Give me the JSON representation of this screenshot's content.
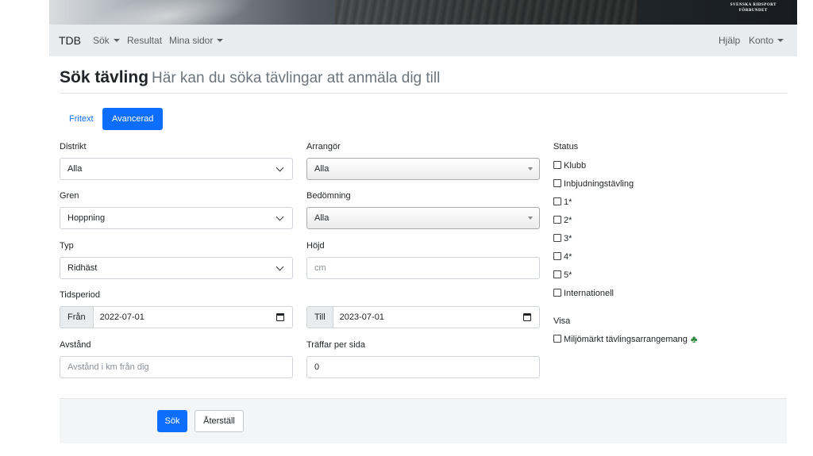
{
  "banner": {
    "logo_line1": "SVENSKA RIDSPORT",
    "logo_line2": "FÖRBUNDET"
  },
  "navbar": {
    "brand": "TDB",
    "items": [
      {
        "label": "Sök",
        "dropdown": true
      },
      {
        "label": "Resultat",
        "dropdown": false
      },
      {
        "label": "Mina sidor",
        "dropdown": true
      }
    ],
    "right_items": [
      {
        "label": "Hjälp",
        "dropdown": false
      },
      {
        "label": "Konto",
        "dropdown": true
      }
    ]
  },
  "page": {
    "title": "Sök tävling",
    "subtitle": "Här kan du söka tävlingar att anmäla dig till"
  },
  "tabs": [
    {
      "label": "Fritext",
      "active": false
    },
    {
      "label": "Avancerad",
      "active": true
    }
  ],
  "form": {
    "distrikt": {
      "label": "Distrikt",
      "value": "Alla"
    },
    "arrangor": {
      "label": "Arrangör",
      "value": "Alla"
    },
    "gren": {
      "label": "Gren",
      "value": "Hoppning"
    },
    "bedomning": {
      "label": "Bedömning",
      "value": "Alla"
    },
    "typ": {
      "label": "Typ",
      "value": "Ridhäst"
    },
    "hojd": {
      "label": "Höjd",
      "value": "",
      "placeholder": "cm"
    },
    "tidsperiod": {
      "label": "Tidsperiod",
      "from_label": "Från",
      "from_value": "2022-07-01",
      "to_label": "Till",
      "to_value": "2023-07-01"
    },
    "avstand": {
      "label": "Avstånd",
      "value": "",
      "placeholder": "Avstånd i km från dig"
    },
    "traffar": {
      "label": "Träffar per sida",
      "value": "0"
    }
  },
  "status": {
    "label": "Status",
    "options": [
      {
        "label": "Klubb",
        "checked": false
      },
      {
        "label": "Inbjudningstävling",
        "checked": false
      },
      {
        "label": "1*",
        "checked": false
      },
      {
        "label": "2*",
        "checked": false
      },
      {
        "label": "3*",
        "checked": false
      },
      {
        "label": "4*",
        "checked": false
      },
      {
        "label": "5*",
        "checked": false
      },
      {
        "label": "Internationell",
        "checked": false
      }
    ]
  },
  "visa": {
    "label": "Visa",
    "options": [
      {
        "label": "Miljömärkt tävlingsarrangemang",
        "checked": false,
        "icon": "clover-icon"
      }
    ]
  },
  "actions": {
    "search_label": "Sök",
    "reset_label": "Återställ"
  },
  "colors": {
    "primary": "#0d6efd",
    "navbar_bg": "#e9ecef",
    "clover": "#2e8b3d"
  }
}
